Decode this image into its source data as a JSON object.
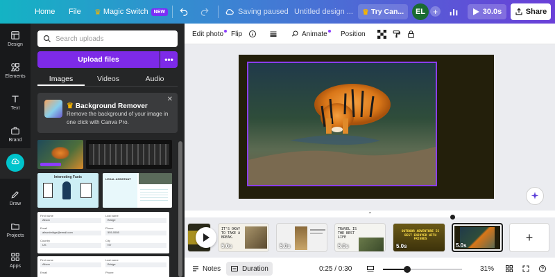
{
  "topbar": {
    "home": "Home",
    "file": "File",
    "magic_switch": "Magic Switch",
    "new_badge": "NEW",
    "saving_status": "Saving paused",
    "doc_title": "Untitled design ...",
    "try_canva": "Try Can...",
    "avatar_initials": "EL",
    "play_duration": "30.0s",
    "share": "Share"
  },
  "rail": {
    "items": [
      {
        "label": "Design",
        "icon": "layout-icon"
      },
      {
        "label": "Elements",
        "icon": "shapes-icon"
      },
      {
        "label": "Text",
        "icon": "text-icon"
      },
      {
        "label": "Brand",
        "icon": "briefcase-icon"
      },
      {
        "label": "Uploads",
        "icon": "cloud-upload-icon"
      },
      {
        "label": "Draw",
        "icon": "pen-icon"
      },
      {
        "label": "Projects",
        "icon": "folder-icon"
      },
      {
        "label": "Apps",
        "icon": "apps-icon"
      }
    ]
  },
  "panel": {
    "search_placeholder": "Search uploads",
    "upload_button": "Upload files",
    "more_button": "•••",
    "tabs": [
      "Images",
      "Videos",
      "Audio"
    ],
    "active_tab": "Images",
    "bg_remover": {
      "title": "Background Remover",
      "description": "Remove the background of your image in one click with Canva Pro.",
      "close": "✕"
    },
    "thumbs": {
      "infographic_title": "Interesting Facts",
      "card_label": "LEGAL ASSISTANT",
      "form_fields": [
        "First name",
        "Last name",
        "Email",
        "Phone",
        "Country",
        "City"
      ],
      "form_values": [
        "Alison",
        "Bridge",
        "alisonbridge@email.com",
        "555-5555",
        "US",
        "NY"
      ]
    }
  },
  "toolbar": {
    "edit_photo": "Edit photo",
    "flip": "Flip",
    "animate": "Animate",
    "position": "Position"
  },
  "timeline": {
    "clips": [
      {
        "duration": "5.0s",
        "caption": "IT'S OKAY TO TAKE A BREAK."
      },
      {
        "duration": "5.0s",
        "caption": ""
      },
      {
        "duration": "5.0s",
        "caption": "TRAVEL IS THE BEST LIFE"
      },
      {
        "duration": "5.0s",
        "caption": "OUTDOOR ADVENTURE IS BEST ENJOYED WITH FRIENDS"
      },
      {
        "duration": "5.0s",
        "caption": ""
      }
    ],
    "add_label": "+"
  },
  "footer": {
    "notes": "Notes",
    "duration": "Duration",
    "time": "0:25 / 0:30",
    "zoom": "31%",
    "progress": 0.31
  },
  "colors": {
    "accent": "#8b3dff",
    "upload_button": "#7d2ae8",
    "rail_bg": "#18191b",
    "panel_bg": "#252627",
    "uploads_active": "#00c4cc"
  }
}
